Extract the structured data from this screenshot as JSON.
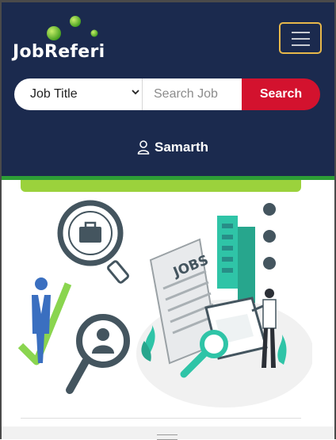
{
  "brand": {
    "logo_text": "JobReferi"
  },
  "nav": {
    "menu_icon": "hamburger-menu-icon"
  },
  "search": {
    "category_selected": "Job Title",
    "input_placeholder": "Search Job",
    "button_label": "Search"
  },
  "user": {
    "name": "Samarth",
    "icon": "user-icon"
  },
  "hero": {
    "illustration": "job-search-illustration",
    "sign_text": "JOBS"
  },
  "colors": {
    "header_bg": "#1b2a4e",
    "accent_red": "#d3122e",
    "accent_green": "#9bd23c",
    "toggler_border": "#e8b84a",
    "teal": "#2fc4a7"
  }
}
